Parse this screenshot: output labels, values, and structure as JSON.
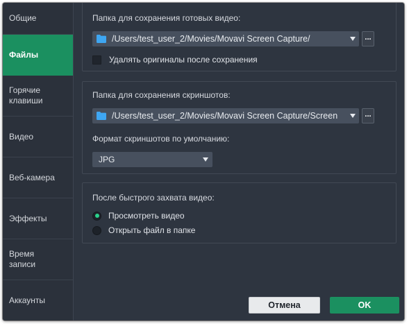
{
  "sidebar": {
    "items": [
      {
        "label": "Общие"
      },
      {
        "label": "Файлы"
      },
      {
        "label": "Горячие\nклавиши"
      },
      {
        "label": "Видео"
      },
      {
        "label": "Веб-камера"
      },
      {
        "label": "Эффекты"
      },
      {
        "label": "Время\nзаписи"
      },
      {
        "label": "Аккаунты"
      }
    ],
    "active": "Файлы"
  },
  "video_section": {
    "label": "Папка для сохранения готовых видео:",
    "path": "/Users/test_user_2/Movies/Movavi Screen Capture/",
    "browse_label": "...",
    "delete_originals": {
      "label": "Удалять оригиналы после сохранения",
      "checked": false
    }
  },
  "screenshot_section": {
    "label": "Папка для сохранения скриншотов:",
    "path": "/Users/test_user_2/Movies/Movavi Screen Capture/Screen",
    "browse_label": "...",
    "format_label": "Формат скриншотов по умолчанию:",
    "format_value": "JPG"
  },
  "capture_section": {
    "label": "После быстрого захвата видео:",
    "options": [
      {
        "label": "Просмотреть видео",
        "selected": true
      },
      {
        "label": "Открыть файл в папке",
        "selected": false
      }
    ]
  },
  "buttons": {
    "cancel_label": "Отмена",
    "ok_label": "OK"
  },
  "colors": {
    "accent": "#1b9060",
    "radio_selected": "#2ad08b",
    "folder_icon": "#3ea6f2"
  },
  "icons": {
    "folder": "folder-icon",
    "dropdown": "chevron-down-icon"
  }
}
